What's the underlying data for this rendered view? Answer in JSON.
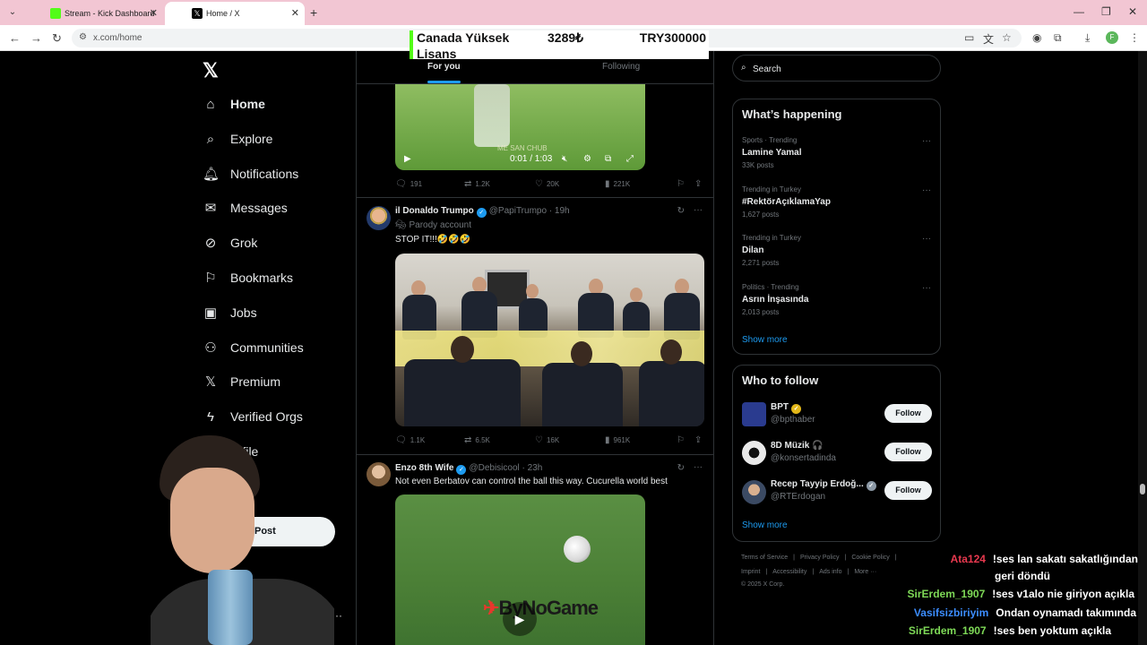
{
  "browser": {
    "tabs": [
      {
        "title": "Stream - Kick Dashboard",
        "favicon_color": "#53fc18"
      },
      {
        "title": "Home / X",
        "favicon_color": "#000000"
      }
    ],
    "url": "x.com/home",
    "profile_initial": "F"
  },
  "ticker": {
    "col1": "Canada Yüksek",
    "col1_line2": "Lisans",
    "col2": "3289₺",
    "col3": "TRY300000"
  },
  "nav": {
    "items": [
      {
        "label": "Home",
        "icon": "home-icon"
      },
      {
        "label": "Explore",
        "icon": "search-icon"
      },
      {
        "label": "Notifications",
        "icon": "bell-icon"
      },
      {
        "label": "Messages",
        "icon": "mail-icon"
      },
      {
        "label": "Grok",
        "icon": "grok-icon"
      },
      {
        "label": "Bookmarks",
        "icon": "bookmark-icon"
      },
      {
        "label": "Jobs",
        "icon": "briefcase-icon"
      },
      {
        "label": "Communities",
        "icon": "people-icon"
      },
      {
        "label": "Premium",
        "icon": "x-icon"
      },
      {
        "label": "Verified Orgs",
        "icon": "lightning-icon"
      },
      {
        "label": "rofile",
        "icon": "profile-icon"
      },
      {
        "label": "e",
        "icon": "more-icon"
      }
    ],
    "post_label": "Post"
  },
  "feed": {
    "tabs": [
      "For you",
      "Following"
    ],
    "video1": {
      "time": "0:01 / 1:03",
      "watermark": "ME SAN CHUB"
    },
    "stats1": {
      "replies": "191",
      "reposts": "1.2K",
      "likes": "20K",
      "views": "221K"
    },
    "tweet2": {
      "name": "il Donaldo Trumpo",
      "handle": "@PapiTrumpo",
      "time": "· 19h",
      "parody": "Parody account",
      "text": "STOP IT!!!🤣🤣🤣",
      "stats": {
        "replies": "1.1K",
        "reposts": "6.5K",
        "likes": "16K",
        "views": "961K"
      }
    },
    "tweet3": {
      "name": "Enzo 8th Wife",
      "handle": "@Debisicool",
      "time": "· 23h",
      "text": "Not even Berbatov can control the ball this way. Cucurella world best",
      "watermark": "ByNoGame"
    }
  },
  "right": {
    "search_placeholder": "Search",
    "happening_title": "What’s happening",
    "trends": [
      {
        "meta": "Sports · Trending",
        "name": "Lamine Yamal",
        "count": "33K posts"
      },
      {
        "meta": "Trending in Turkey",
        "name": "#RektörAçıklamaYap",
        "count": "1,627 posts"
      },
      {
        "meta": "Trending in Turkey",
        "name": "Dilan",
        "count": "2,271 posts"
      },
      {
        "meta": "Politics · Trending",
        "name": "Asrın İnşasında",
        "count": "2,013 posts"
      }
    ],
    "show_more": "Show more",
    "wtf_title": "Who to follow",
    "wtf": [
      {
        "name": "BPT",
        "handle": "@bpthaber",
        "badge": "gold",
        "follow": "Follow",
        "avatar_color": "#2a3b8f"
      },
      {
        "name": "8D Müzik 🎧",
        "handle": "@konsertadinda",
        "badge": "",
        "follow": "Follow",
        "avatar_color": "#e9e9e9"
      },
      {
        "name": "Recep Tayyip Erdoğ...",
        "handle": "@RTErdogan",
        "badge": "grey",
        "follow": "Follow",
        "avatar_color": "#3b4a63"
      }
    ],
    "footer": {
      "line1": [
        "Terms of Service",
        "|",
        "Privacy Policy",
        "|",
        "Cookie Policy",
        "|"
      ],
      "line2": [
        "Imprint",
        "|",
        "Accessibility",
        "|",
        "Ads info",
        "|",
        "More ···"
      ],
      "copyright": "© 2025 X Corp."
    }
  },
  "chat": [
    {
      "user": "Ata124",
      "color": "#e8394f",
      "msg": "!ses lan sakatı sakatlığından"
    },
    {
      "user": "",
      "color": "#ffffff",
      "msg": "geri döndü"
    },
    {
      "user": "SirErdem_1907",
      "color": "#7ed957",
      "msg": "!ses v1alo nie giriyon açıkla"
    },
    {
      "user": "Vasifsizbiriyim",
      "color": "#3c8dff",
      "msg": "Ondan oynamadı takımında"
    },
    {
      "user": "SirErdem_1907",
      "color": "#7ed957",
      "msg": "!ses ben yoktum açıkla"
    }
  ]
}
